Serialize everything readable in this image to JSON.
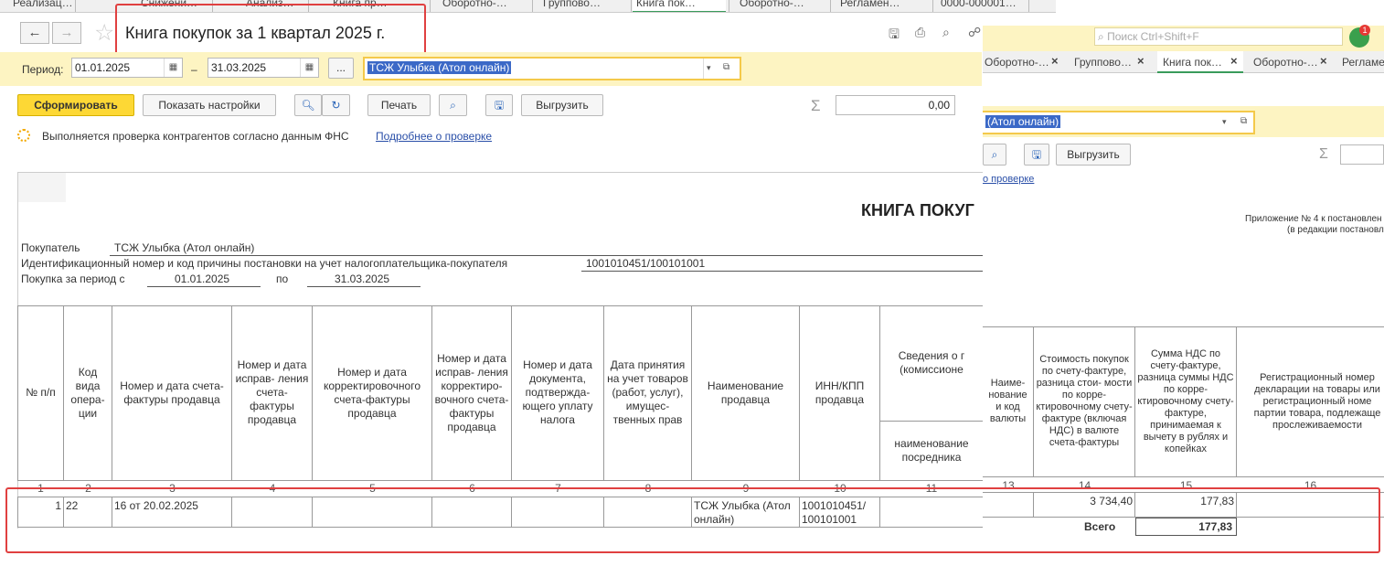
{
  "tabs": [
    {
      "label": "Реализац…"
    },
    {
      "label": "Снижени…"
    },
    {
      "label": "Анализ…"
    },
    {
      "label": "Книга пр…"
    },
    {
      "label": "Оборотно-…"
    },
    {
      "label": "Группово…"
    },
    {
      "label": "Книга пок…"
    },
    {
      "label": "Оборотно-…"
    },
    {
      "label": "Регламен…"
    },
    {
      "label": "0000-000001…"
    }
  ],
  "title": "Книга покупок за 1 квартал 2025 г.",
  "period": {
    "label": "Период:",
    "from": "01.01.2025",
    "to": "31.03.2025",
    "dash": "–",
    "more": "...",
    "org": "ТСЖ Улыбка (Атол онлайн)"
  },
  "buttons": {
    "form": "Сформировать",
    "settings": "Показать настройки",
    "print": "Печать",
    "export": "Выгрузить"
  },
  "sum_value": "0,00",
  "sigma": "Σ",
  "check": {
    "text": "Выполняется проверка контрагентов согласно данным ФНС",
    "link": "Подробнее о проверке",
    "link_short": "о проверке"
  },
  "right": {
    "search_placeholder": "Поиск Ctrl+Shift+F",
    "notif_count": "1",
    "tabs": [
      {
        "label": "Оборотно-…"
      },
      {
        "label": "Группово…"
      },
      {
        "label": "Книга пок…"
      },
      {
        "label": "Оборотно-…"
      },
      {
        "label": "Регламе"
      }
    ],
    "org_short": "(Атол онлайн)",
    "appendix1": "Приложение № 4 к постановлен",
    "appendix2": "(в редакции постановл"
  },
  "report": {
    "heading": "КНИГА ПОКУГ",
    "buyer_label": "Покупатель",
    "buyer": "ТСЖ Улыбка (Атол онлайн)",
    "inn_label": "Идентификационный номер и код причины постановки на учет налогоплательщика-покупателя",
    "inn": "1001010451/100101001",
    "period_label": "Покупка за период с",
    "period_from": "01.01.2025",
    "period_to_label": "по",
    "period_to": "31.03.2025",
    "headers": {
      "c1": "№ п/п",
      "c2": "Код вида опера- ции",
      "c3": "Номер и дата счета-фактуры продавца",
      "c4": "Номер и дата исправ- ления счета- фактуры продавца",
      "c5": "Номер и дата корректировочного счета-фактуры продавца",
      "c6": "Номер и дата исправ- ления корректиро- вочного счета- фактуры продавца",
      "c7": "Номер и дата документа, подтвержда- ющего уплату налога",
      "c8": "Дата принятия на учет товаров (работ, услуг), имущес- твенных прав",
      "c9": "Наименование продавца",
      "c10": "ИНН/КПП продавца",
      "c11_group": "Сведения о г (комиссионе",
      "c11": "наименование посредника",
      "c13": "Наиме- нование и код валюты",
      "c14": "Стоимость покупок по счету-фактуре, разница стои- мости по корре- ктировочному счету-фактуре (включая НДС) в валюте счета-фактуры",
      "c15": "Сумма НДС по счету-фактуре, разница суммы НДС по корре- ктировочному счету-фактуре, принимаемая к вычету в рублях и копейках",
      "c16": "Регистрационный номер декларации на товары или регистрационный номе партии товара, подлежаще прослеживаемости"
    },
    "col_numbers": [
      "1",
      "2",
      "3",
      "4",
      "5",
      "6",
      "7",
      "8",
      "9",
      "10",
      "11",
      "13",
      "14",
      "15",
      "16"
    ],
    "row": {
      "n": "1",
      "code": "22",
      "invoice": "16 от 20.02.2025",
      "seller": "ТСЖ Улыбка (Атол онлайн)",
      "inn": "1001010451/ 100101001",
      "cost": "3 734,40",
      "vat": "177,83"
    },
    "total_label": "Всего",
    "total_vat": "177,83"
  }
}
